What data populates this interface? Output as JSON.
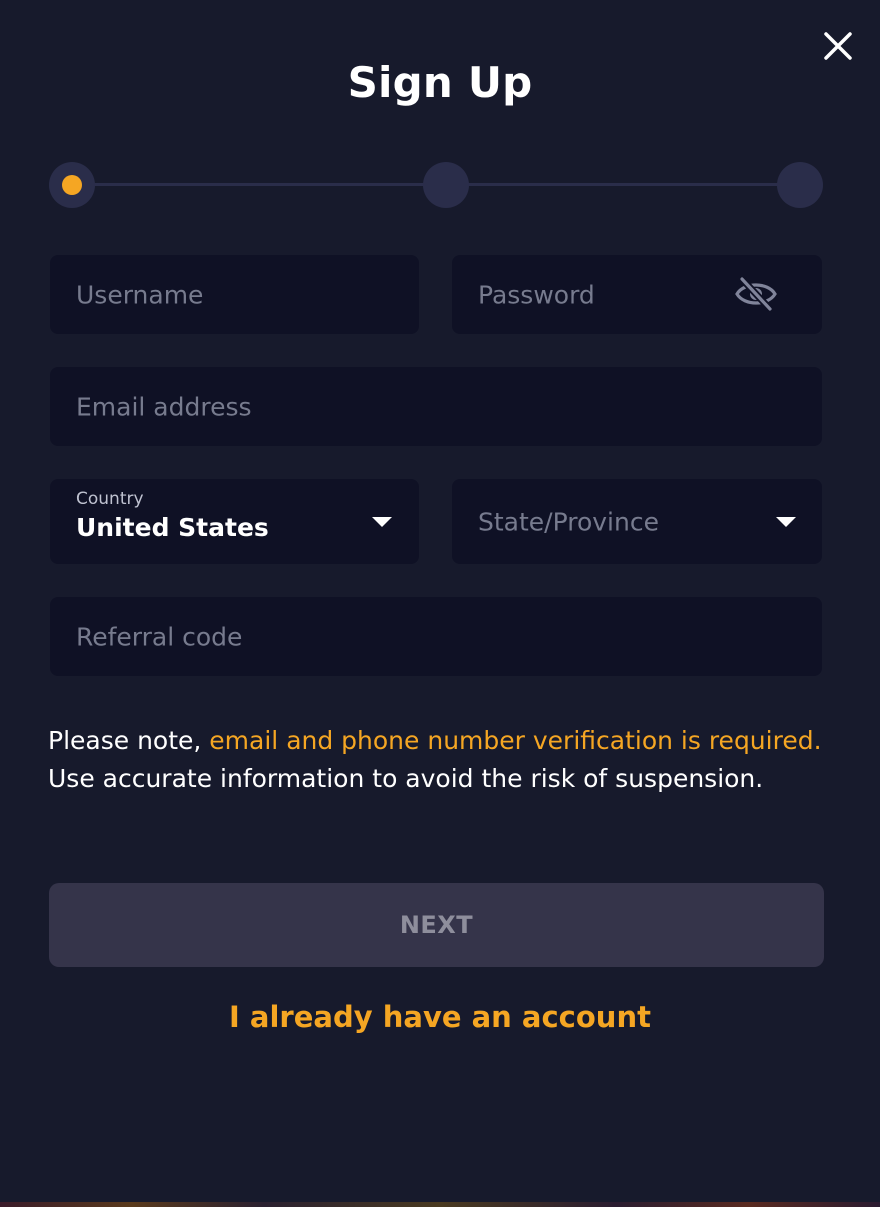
{
  "modal": {
    "title": "Sign Up",
    "close_icon": "close-icon"
  },
  "stepper": {
    "current_step": 1,
    "total_steps": 3
  },
  "form": {
    "username": {
      "placeholder": "Username",
      "value": ""
    },
    "password": {
      "placeholder": "Password",
      "value": "",
      "toggle_icon": "eye-slash-icon"
    },
    "email": {
      "placeholder": "Email address",
      "value": ""
    },
    "country": {
      "label": "Country",
      "value": "United States",
      "icon": "chevron-down-icon"
    },
    "state": {
      "placeholder": "State/Province",
      "value": "",
      "icon": "chevron-down-icon"
    },
    "referral": {
      "placeholder": "Referral code",
      "value": ""
    }
  },
  "notice": {
    "prefix": "Please note, ",
    "highlight": "email and phone number verification is required.",
    "suffix": " Use accurate information to avoid the risk of suspension."
  },
  "actions": {
    "next_label": "NEXT",
    "account_link": "I already have an account"
  },
  "colors": {
    "background": "#171a2c",
    "field_background": "#0f1125",
    "accent": "#f5a623",
    "button_disabled": "#35344a"
  }
}
